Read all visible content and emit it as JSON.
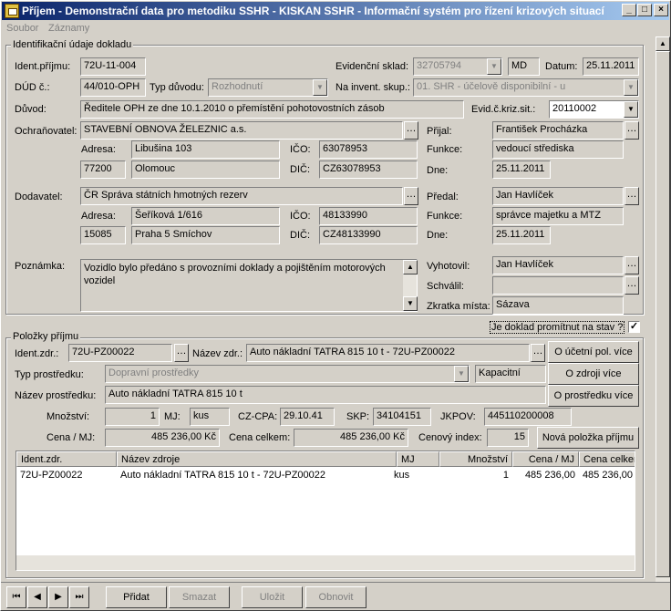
{
  "window": {
    "title": "Příjem - Demonstrační data pro metodiku SSHR - KISKAN SSHR - Informační systém pro řízení krizových situací"
  },
  "menu": {
    "items": [
      "Soubor",
      "Záznamy"
    ]
  },
  "ident": {
    "group_title": "Identifikační údaje dokladu",
    "ident_prijmu_label": "Ident.příjmu:",
    "ident_prijmu": "72U-11-004",
    "dud_label": "DÚD č.:",
    "dud": "44/010-OPH",
    "typ_duvodu_label": "Typ důvodu:",
    "typ_duvodu": "Rozhodnutí",
    "evid_sklad_label": "Evidenční sklad:",
    "evid_sklad": "32705794",
    "evid_sklad_code": "MD",
    "datum_label": "Datum:",
    "datum": "25.11.2011",
    "na_invent_label": "Na invent. skup.:",
    "na_invent": "01. SHR - účelově disponibilní - u",
    "duvod_label": "Důvod:",
    "duvod": "Ředitele OPH ze dne 10.1.2010 o přemístění pohotovostních zásob",
    "evid_kriz_label": "Evid.č.kriz.sit.:",
    "evid_kriz": "20110002",
    "ochranovatel_label": "Ochraňovatel:",
    "ochranovatel": "STAVEBNÍ OBNOVA ŽELEZNIC a.s.",
    "och_adresa_label": "Adresa:",
    "och_adresa": "Libušina 103",
    "och_psc": "77200",
    "och_mesto": "Olomouc",
    "och_ico_label": "IČO:",
    "och_ico": "63078953",
    "och_dic_label": "DIČ:",
    "och_dic": "CZ63078953",
    "prijal_label": "Přijal:",
    "prijal": "František Procházka",
    "prijal_funkce_label": "Funkce:",
    "prijal_funkce": "vedoucí střediska",
    "prijal_dne_label": "Dne:",
    "prijal_dne": "25.11.2011",
    "dodavatel_label": "Dodavatel:",
    "dodavatel": "ČR Správa státních hmotných rezerv",
    "dod_adresa_label": "Adresa:",
    "dod_adresa": "Šeříková 1/616",
    "dod_psc": "15085",
    "dod_mesto": "Praha 5 Smíchov",
    "dod_ico_label": "IČO:",
    "dod_ico": "48133990",
    "dod_dic_label": "DIČ:",
    "dod_dic": "CZ48133990",
    "predal_label": "Předal:",
    "predal": "Jan Havlíček",
    "predal_funkce_label": "Funkce:",
    "predal_funkce": "správce majetku a MTZ",
    "predal_dne_label": "Dne:",
    "predal_dne": "25.11.2011",
    "poznamka_label": "Poznámka:",
    "poznamka": "Vozidlo bylo předáno s provozními doklady a pojištěním motorových vozidel",
    "vyhotovil_label": "Vyhotovil:",
    "vyhotovil": "Jan Havlíček",
    "schvalil_label": "Schválil:",
    "schvalil": "",
    "zkratka_label": "Zkratka místa:",
    "zkratka": "Sázava",
    "promitnut_label": "Je doklad promítnut na stav ?",
    "promitnut_check": "✓"
  },
  "polozky": {
    "group_title": "Položky příjmu",
    "ident_zdr_label": "Ident.zdr.:",
    "ident_zdr": "72U-PZ00022",
    "nazev_zdr_label": "Název zdr.:",
    "nazev_zdr": "Auto nákladní TATRA 815 10 t - 72U-PZ00022",
    "typ_prostredku_label": "Typ prostředku:",
    "typ_prostredku": "Dopravní prostředky",
    "kapacitni": "Kapacitní",
    "nazev_prostredku_label": "Název prostředku:",
    "nazev_prostredku": "Auto nákladní TATRA 815 10 t",
    "mnozstvi_label": "Množství:",
    "mnozstvi": "1",
    "mj_label": "MJ:",
    "mj": "kus",
    "czcpa_label": "CZ-CPA:",
    "czcpa": "29.10.41",
    "skp_label": "SKP:",
    "skp": "34104151",
    "jkpov_label": "JKPOV:",
    "jkpov": "445110200008",
    "cena_mj_label": "Cena / MJ:",
    "cena_mj": "485 236,00 Kč",
    "cena_celkem_label": "Cena celkem:",
    "cena_celkem": "485 236,00 Kč",
    "cenovy_index_label": "Cenový index:",
    "cenovy_index": "15",
    "btn_ucetni": "O účetní pol. více",
    "btn_zdroji": "O zdroji více",
    "btn_prostredku": "O prostředku více",
    "btn_nova": "Nová položka příjmu"
  },
  "table": {
    "headers": [
      "Ident.zdr.",
      "Název zdroje",
      "MJ",
      "Množství",
      "Cena / MJ",
      "Cena celkem"
    ],
    "rows": [
      [
        "72U-PZ00022",
        "Auto nákladní TATRA 815 10 t - 72U-PZ00022",
        "kus",
        "1",
        "485 236,00",
        "485 236,00"
      ]
    ]
  },
  "nav": {
    "first": "⏮",
    "prev": "◀",
    "next": "▶",
    "last": "⏭"
  },
  "actions": {
    "pridat": "Přidat",
    "smazat": "Smazat",
    "ulozit": "Uložit",
    "obnovit": "Obnovit"
  },
  "titlebar_buttons": {
    "min": "_",
    "max": "□",
    "close": "×"
  },
  "scroll": {
    "up": "▲",
    "down": "▼",
    "dd": "▼"
  }
}
